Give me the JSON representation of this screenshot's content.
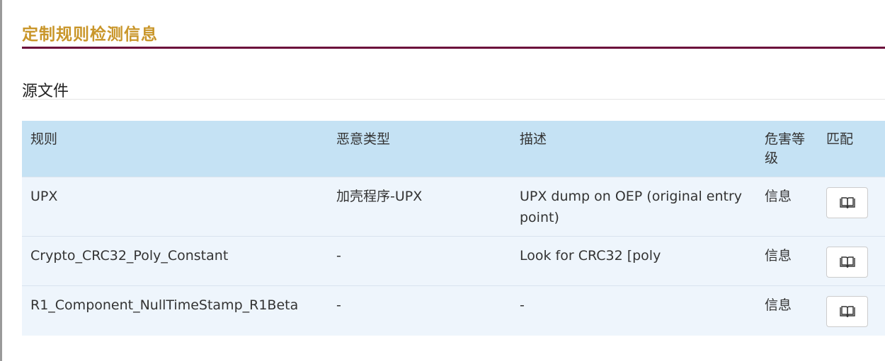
{
  "section_title": "定制规则检测信息",
  "sub_title": "源文件",
  "table": {
    "headers": {
      "rule": "规则",
      "type": "恶意类型",
      "desc": "描述",
      "level": "危害等级",
      "match": "匹配"
    },
    "rows": [
      {
        "rule": "UPX",
        "type": "加壳程序-UPX",
        "desc": "UPX dump on OEP (original entry point)",
        "level": "信息",
        "match_icon": "book-icon"
      },
      {
        "rule": "Crypto_CRC32_Poly_Constant",
        "type": "-",
        "desc": "Look for CRC32 [poly",
        "level": "信息",
        "match_icon": "book-icon"
      },
      {
        "rule": "R1_Component_NullTimeStamp_R1Beta",
        "type": "-",
        "desc": "-",
        "level": "信息",
        "match_icon": "book-icon"
      }
    ]
  },
  "colors": {
    "title": "#c9962a",
    "title_rule": "#6b0a3a",
    "header_bg": "#c5e2f4",
    "row_bg": "#eef5fc"
  }
}
